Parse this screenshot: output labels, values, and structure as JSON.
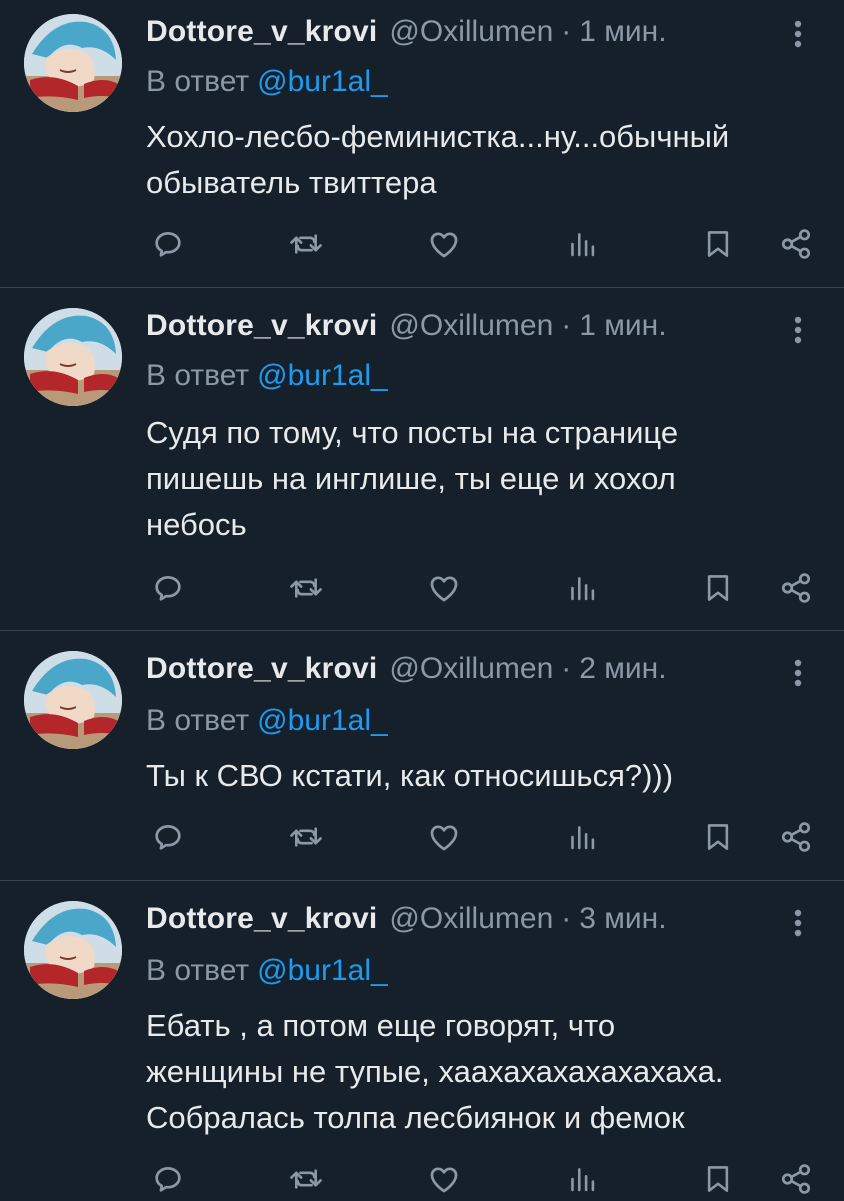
{
  "colors": {
    "background": "#15202b",
    "divider": "#38444d",
    "text_primary": "#e7e9ea",
    "text_secondary": "#8b98a5",
    "mention": "#1d9bf0"
  },
  "icons": {
    "reply": "reply-icon",
    "retweet": "retweet-icon",
    "like": "heart-icon",
    "views": "views-icon",
    "bookmark": "bookmark-icon",
    "share": "share-icon",
    "more": "more-vertical-icon"
  },
  "tweets": [
    {
      "display_name": "Dottore_v_krovi",
      "handle": "@Oxillumen",
      "separator": "·",
      "time": "1 мин.",
      "reply_prefix": "В ответ",
      "reply_to": "@bur1al_",
      "text_lines": [
        "Хохло-лесбо-феминистка...ну...обычный",
        "обыватель твиттера"
      ]
    },
    {
      "display_name": "Dottore_v_krovi",
      "handle": "@Oxillumen",
      "separator": "·",
      "time": "1 мин.",
      "reply_prefix": "В ответ",
      "reply_to": "@bur1al_",
      "text_lines": [
        "Судя по тому, что посты на странице",
        "пишешь на инглише, ты еще и хохол",
        "небось"
      ]
    },
    {
      "display_name": "Dottore_v_krovi",
      "handle": "@Oxillumen",
      "separator": "·",
      "time": "2 мин.",
      "reply_prefix": "В ответ",
      "reply_to": "@bur1al_",
      "text_lines": [
        "Ты к СВО кстати, как относишься?)))"
      ]
    },
    {
      "display_name": "Dottore_v_krovi",
      "handle": "@Oxillumen",
      "separator": "·",
      "time": "3 мин.",
      "reply_prefix": "В ответ",
      "reply_to": "@bur1al_",
      "text_lines": [
        "Ебать , а потом еще говорят, что",
        "женщины не тупые, хаахахахахахахаха.",
        "Собралась толпа лесбиянок и фемок"
      ]
    }
  ]
}
